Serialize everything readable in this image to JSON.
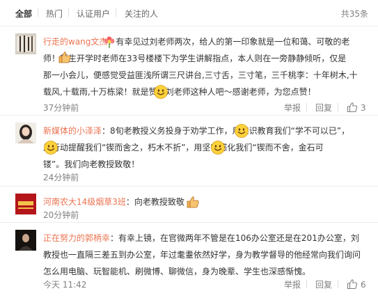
{
  "tabs": [
    {
      "label": "全部",
      "active": true
    },
    {
      "label": "热门",
      "active": false
    },
    {
      "label": "认证用户",
      "active": false
    },
    {
      "label": "关注的人",
      "active": false
    }
  ],
  "total_label": "共35条",
  "actions": {
    "report": "举报",
    "reply": "回复"
  },
  "comments": [
    {
      "username": "行走的wang文杰",
      "lines": [
        "：有幸见过刘老师两次，给人的第一印象就是一位和蔼、可敬的老",
        "师！新生开学时老师在33号楼楼下为学生讲解指点，本人则在一旁静静倾听，仅是",
        "那一小会儿，便感觉受益匪浅所谓三尺讲台,三寸舌，三寸笔，三千桃李：十年树木,十",
        "载风,十载雨,十万栋梁！就是赞美刘老师这种人吧～感谢老师，为您点赞！"
      ],
      "time": "37分钟前",
      "likes": "3"
    },
    {
      "username": "新媒体的小泽泽",
      "lines": [
        "：8旬老教授义务投身于劝学工作，用知识教育我们“学不可以已”，",
        "用行动提醒我们“锲而舍之，朽木不折”，用坚守感化我们“锲而不舍，金石可",
        "镂”。我们向老教授致敬！"
      ],
      "time": "24分钟前"
    },
    {
      "username": "河南农大14级烟草3班",
      "lines": [
        "：向老教授致敬"
      ],
      "time": "20分钟前"
    },
    {
      "username": "正在努力的郭柄幸",
      "lines": [
        "：有幸上镜，在官微两年不管是在106办公室还是在201办公室，刘",
        "教授也一直隔三差五到办公室，年过耄耋依然好学，身为教学督导的他经常向我们询问",
        "怎么用电脑、玩智能机、刷微博、聊微信，身为晚辈、学生也深感惭愧。"
      ],
      "time": "今天 11:42",
      "likes": "6"
    }
  ],
  "colors": {
    "username": "#eb7350",
    "text": "#333333",
    "meta": "#808080",
    "divider": "#eeeeee"
  },
  "icons": [
    "user-avatar",
    "flower-emoji",
    "thumbs-up-emoji",
    "smile-emoji",
    "like-icon"
  ]
}
